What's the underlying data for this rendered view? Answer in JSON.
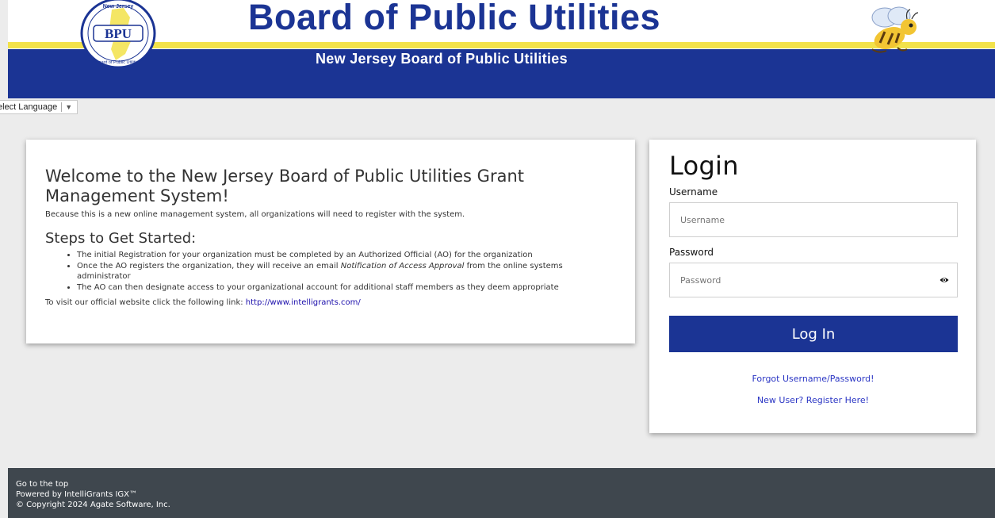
{
  "header": {
    "title": "Board of Public Utilities",
    "subtitle": "New Jersey Board of Public Utilities",
    "seal_text": "BPU",
    "seal_top_text": "New Jersey",
    "seal_bottom_text": "Board of Public Utilities",
    "colors": {
      "navy": "#1b3494",
      "yellow": "#f2e24a"
    }
  },
  "language": {
    "label": "elect Language",
    "arrow": "▼"
  },
  "welcome": {
    "title": "Welcome to the New Jersey Board of Public Utilities Grant Management System!",
    "intro": "Because this is a new online management system, all organizations will need to register with the system.",
    "steps_heading": "Steps to Get Started:",
    "step1": "The initial Registration for your organization must be completed by an Authorized Official (AO) for the organization",
    "step2_before": "Once the AO registers the organization, they will receive an email ",
    "step2_em": "Notification of Access Approval",
    "step2_after": " from the online systems administrator",
    "step3": "The AO can then designate access to your organizational account for additional staff members as they deem appropriate",
    "visit_text": "To visit our official website click the following link: ",
    "visit_link": "http://www.intelligrants.com/"
  },
  "login": {
    "title": "Login",
    "username_label": "Username",
    "username_placeholder": "Username",
    "password_label": "Password",
    "password_placeholder": "Password",
    "button_label": "Log In",
    "forgot_link": "Forgot Username/Password!",
    "register_link": "New User? Register Here!"
  },
  "footer": {
    "top_link": "Go to the top",
    "powered": "Powered by IntelliGrants IGX™",
    "copyright": "© Copyright 2024 Agate Software, Inc."
  }
}
